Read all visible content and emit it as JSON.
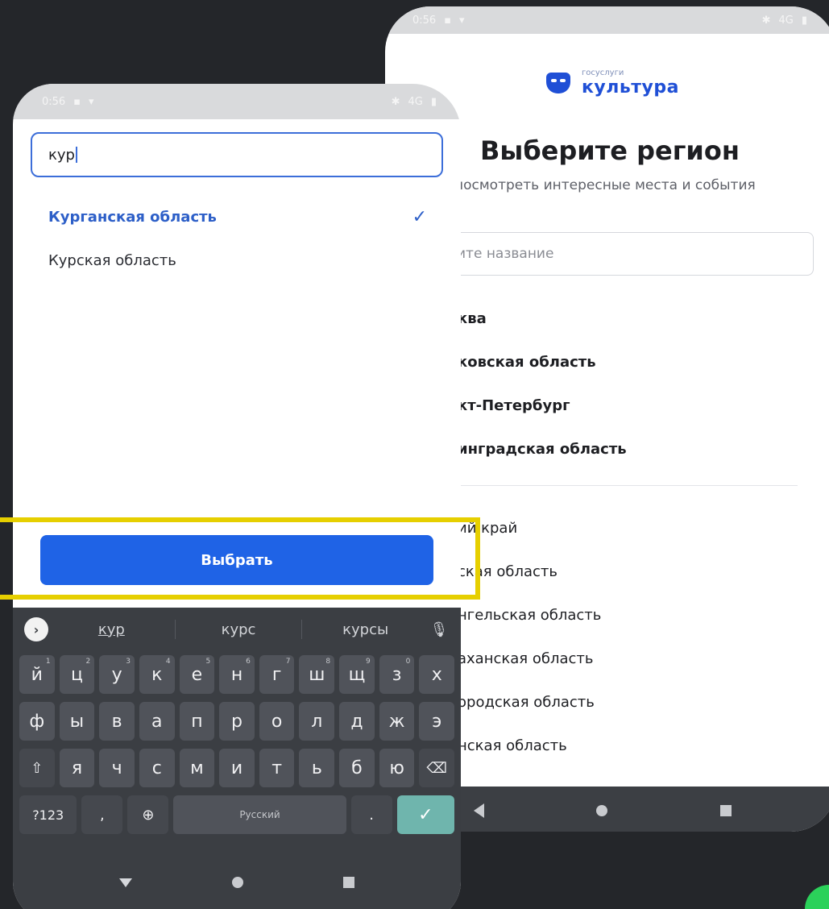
{
  "back_screen": {
    "status": {
      "time": "0:56",
      "signal": "4G"
    },
    "logo": {
      "small_text": "госуслуги",
      "big_text": "культура"
    },
    "title": "Выберите регион",
    "subtitle": "посмотреть интересные места и события",
    "search_placeholder": "ите название",
    "popular_regions": [
      "ква",
      "ковская область",
      "кт-Петербург",
      "инградская область"
    ],
    "regions": [
      "ий край",
      "ская область",
      "нгельская область",
      "аханская область",
      "ородская область",
      "нская область"
    ]
  },
  "front_screen": {
    "status": {
      "time": "0:56",
      "signal": "4G"
    },
    "search_value": "кур",
    "results": [
      {
        "label": "Курганская область",
        "selected": true
      },
      {
        "label": "Курская область",
        "selected": false
      }
    ],
    "select_button": "Выбрать"
  },
  "keyboard": {
    "suggestions": [
      "кур",
      "курс",
      "курсы"
    ],
    "row1": [
      {
        "k": "й",
        "h": "1"
      },
      {
        "k": "ц",
        "h": "2"
      },
      {
        "k": "у",
        "h": "3"
      },
      {
        "k": "к",
        "h": "4"
      },
      {
        "k": "е",
        "h": "5"
      },
      {
        "k": "н",
        "h": "6"
      },
      {
        "k": "г",
        "h": "7"
      },
      {
        "k": "ш",
        "h": "8"
      },
      {
        "k": "щ",
        "h": "9"
      },
      {
        "k": "з",
        "h": "0"
      },
      {
        "k": "х",
        "h": ""
      }
    ],
    "row2": [
      "ф",
      "ы",
      "в",
      "а",
      "п",
      "р",
      "о",
      "л",
      "д",
      "ж",
      "э"
    ],
    "row3": [
      "я",
      "ч",
      "с",
      "м",
      "и",
      "т",
      "ь",
      "б",
      "ю"
    ],
    "symbols_key": "?123",
    "comma_key": ",",
    "space_label": "Русский",
    "period_key": "."
  },
  "colors": {
    "accent": "#1f63e6",
    "highlight": "#e6cf00",
    "background": "#24262a"
  }
}
